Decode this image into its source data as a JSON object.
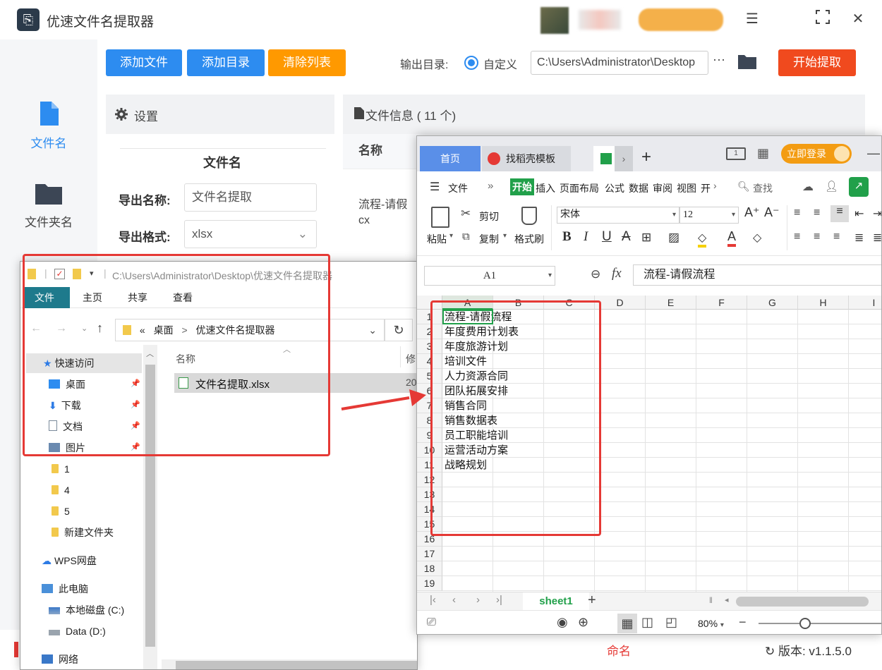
{
  "app": {
    "title": "优速文件名提取器",
    "sidebar": [
      {
        "label": "文件名",
        "active": true
      },
      {
        "label": "文件夹名",
        "active": false
      }
    ],
    "toolbar": {
      "add_file": "添加文件",
      "add_dir": "添加目录",
      "clear_list": "清除列表",
      "output_dir_label": "输出目录:",
      "custom_label": "自定义",
      "output_path": "C:\\Users\\Administrator\\Desktop",
      "more": "···",
      "start": "开始提取"
    },
    "settings": {
      "title": "设置",
      "section": "文件名",
      "export_name_label": "导出名称:",
      "export_name_value": "文件名提取",
      "export_format_label": "导出格式:",
      "export_format_value": "xlsx"
    },
    "file_info": {
      "title": "文件信息  ( 11 个)",
      "column_name": "名称",
      "row_text_1": "流程-请假",
      "row_text_2": "cx"
    },
    "bottom": {
      "partial_text": "命名",
      "version": "版本:  v1.1.5.0"
    }
  },
  "explorer": {
    "title_path": "C:\\Users\\Administrator\\Desktop\\优速文件名提取器",
    "ribbon_tabs": [
      "文件",
      "主页",
      "共享",
      "查看"
    ],
    "breadcrumb": [
      "«",
      "桌面",
      ">",
      "优速文件名提取器"
    ],
    "nav": [
      {
        "label": "快速访问",
        "icon": "star-icon",
        "pinned": false,
        "indent": 0
      },
      {
        "label": "桌面",
        "icon": "desktop-icon",
        "pinned": true,
        "indent": 1
      },
      {
        "label": "下载",
        "icon": "download-icon",
        "pinned": true,
        "indent": 1
      },
      {
        "label": "文档",
        "icon": "document-icon",
        "pinned": true,
        "indent": 1
      },
      {
        "label": "图片",
        "icon": "picture-icon",
        "pinned": true,
        "indent": 1
      },
      {
        "label": "1",
        "icon": "folder-icon",
        "pinned": false,
        "indent": 1
      },
      {
        "label": "4",
        "icon": "folder-icon",
        "pinned": false,
        "indent": 1
      },
      {
        "label": "5",
        "icon": "folder-icon",
        "pinned": false,
        "indent": 1
      },
      {
        "label": "新建文件夹",
        "icon": "folder-icon",
        "pinned": false,
        "indent": 1
      },
      {
        "label": "WPS网盘",
        "icon": "cloud-icon",
        "pinned": false,
        "indent": 0
      },
      {
        "label": "此电脑",
        "icon": "computer-icon",
        "pinned": false,
        "indent": 0
      },
      {
        "label": "本地磁盘 (C:)",
        "icon": "drive-icon",
        "pinned": false,
        "indent": 1
      },
      {
        "label": "Data (D:)",
        "icon": "drive-icon",
        "pinned": false,
        "indent": 1
      },
      {
        "label": "网络",
        "icon": "network-icon",
        "pinned": false,
        "indent": 0
      }
    ],
    "columns": {
      "name": "名称",
      "modified": "修"
    },
    "files": [
      {
        "name": "文件名提取.xlsx",
        "date": "20"
      }
    ]
  },
  "wps": {
    "tabs": {
      "home": "首页",
      "template": "找稻壳模板",
      "login": "立即登录"
    },
    "menu": {
      "file": "文件",
      "items": [
        "开始",
        "插入",
        "页面布局",
        "公式",
        "数据",
        "审阅",
        "视图",
        "开"
      ],
      "search": "查找"
    },
    "toolbar": {
      "paste": "粘贴",
      "cut": "剪切",
      "copy": "复制",
      "format_painter": "格式刷",
      "font": "宋体",
      "size": "12"
    },
    "cell_ref": "A1",
    "fx": "fx",
    "formula": "流程-请假流程",
    "columns": [
      "A",
      "B",
      "C",
      "D",
      "E",
      "F",
      "G",
      "H",
      "I"
    ],
    "rows": [
      "流程-请假流程",
      "年度费用计划表",
      "年度旅游计划",
      "培训文件",
      "人力资源合同",
      "团队拓展安排",
      "销售合同",
      "销售数据表",
      "员工职能培训",
      "运营活动方案",
      "战略规划",
      "",
      "",
      "",
      "",
      "",
      "",
      "",
      ""
    ],
    "row_numbers": [
      "1",
      "2",
      "3",
      "4",
      "5",
      "6",
      "7",
      "8",
      "9",
      "10",
      "11",
      "12",
      "13",
      "14",
      "15",
      "16",
      "17",
      "18",
      "19"
    ],
    "sheet": "sheet1",
    "zoom": "80%"
  }
}
